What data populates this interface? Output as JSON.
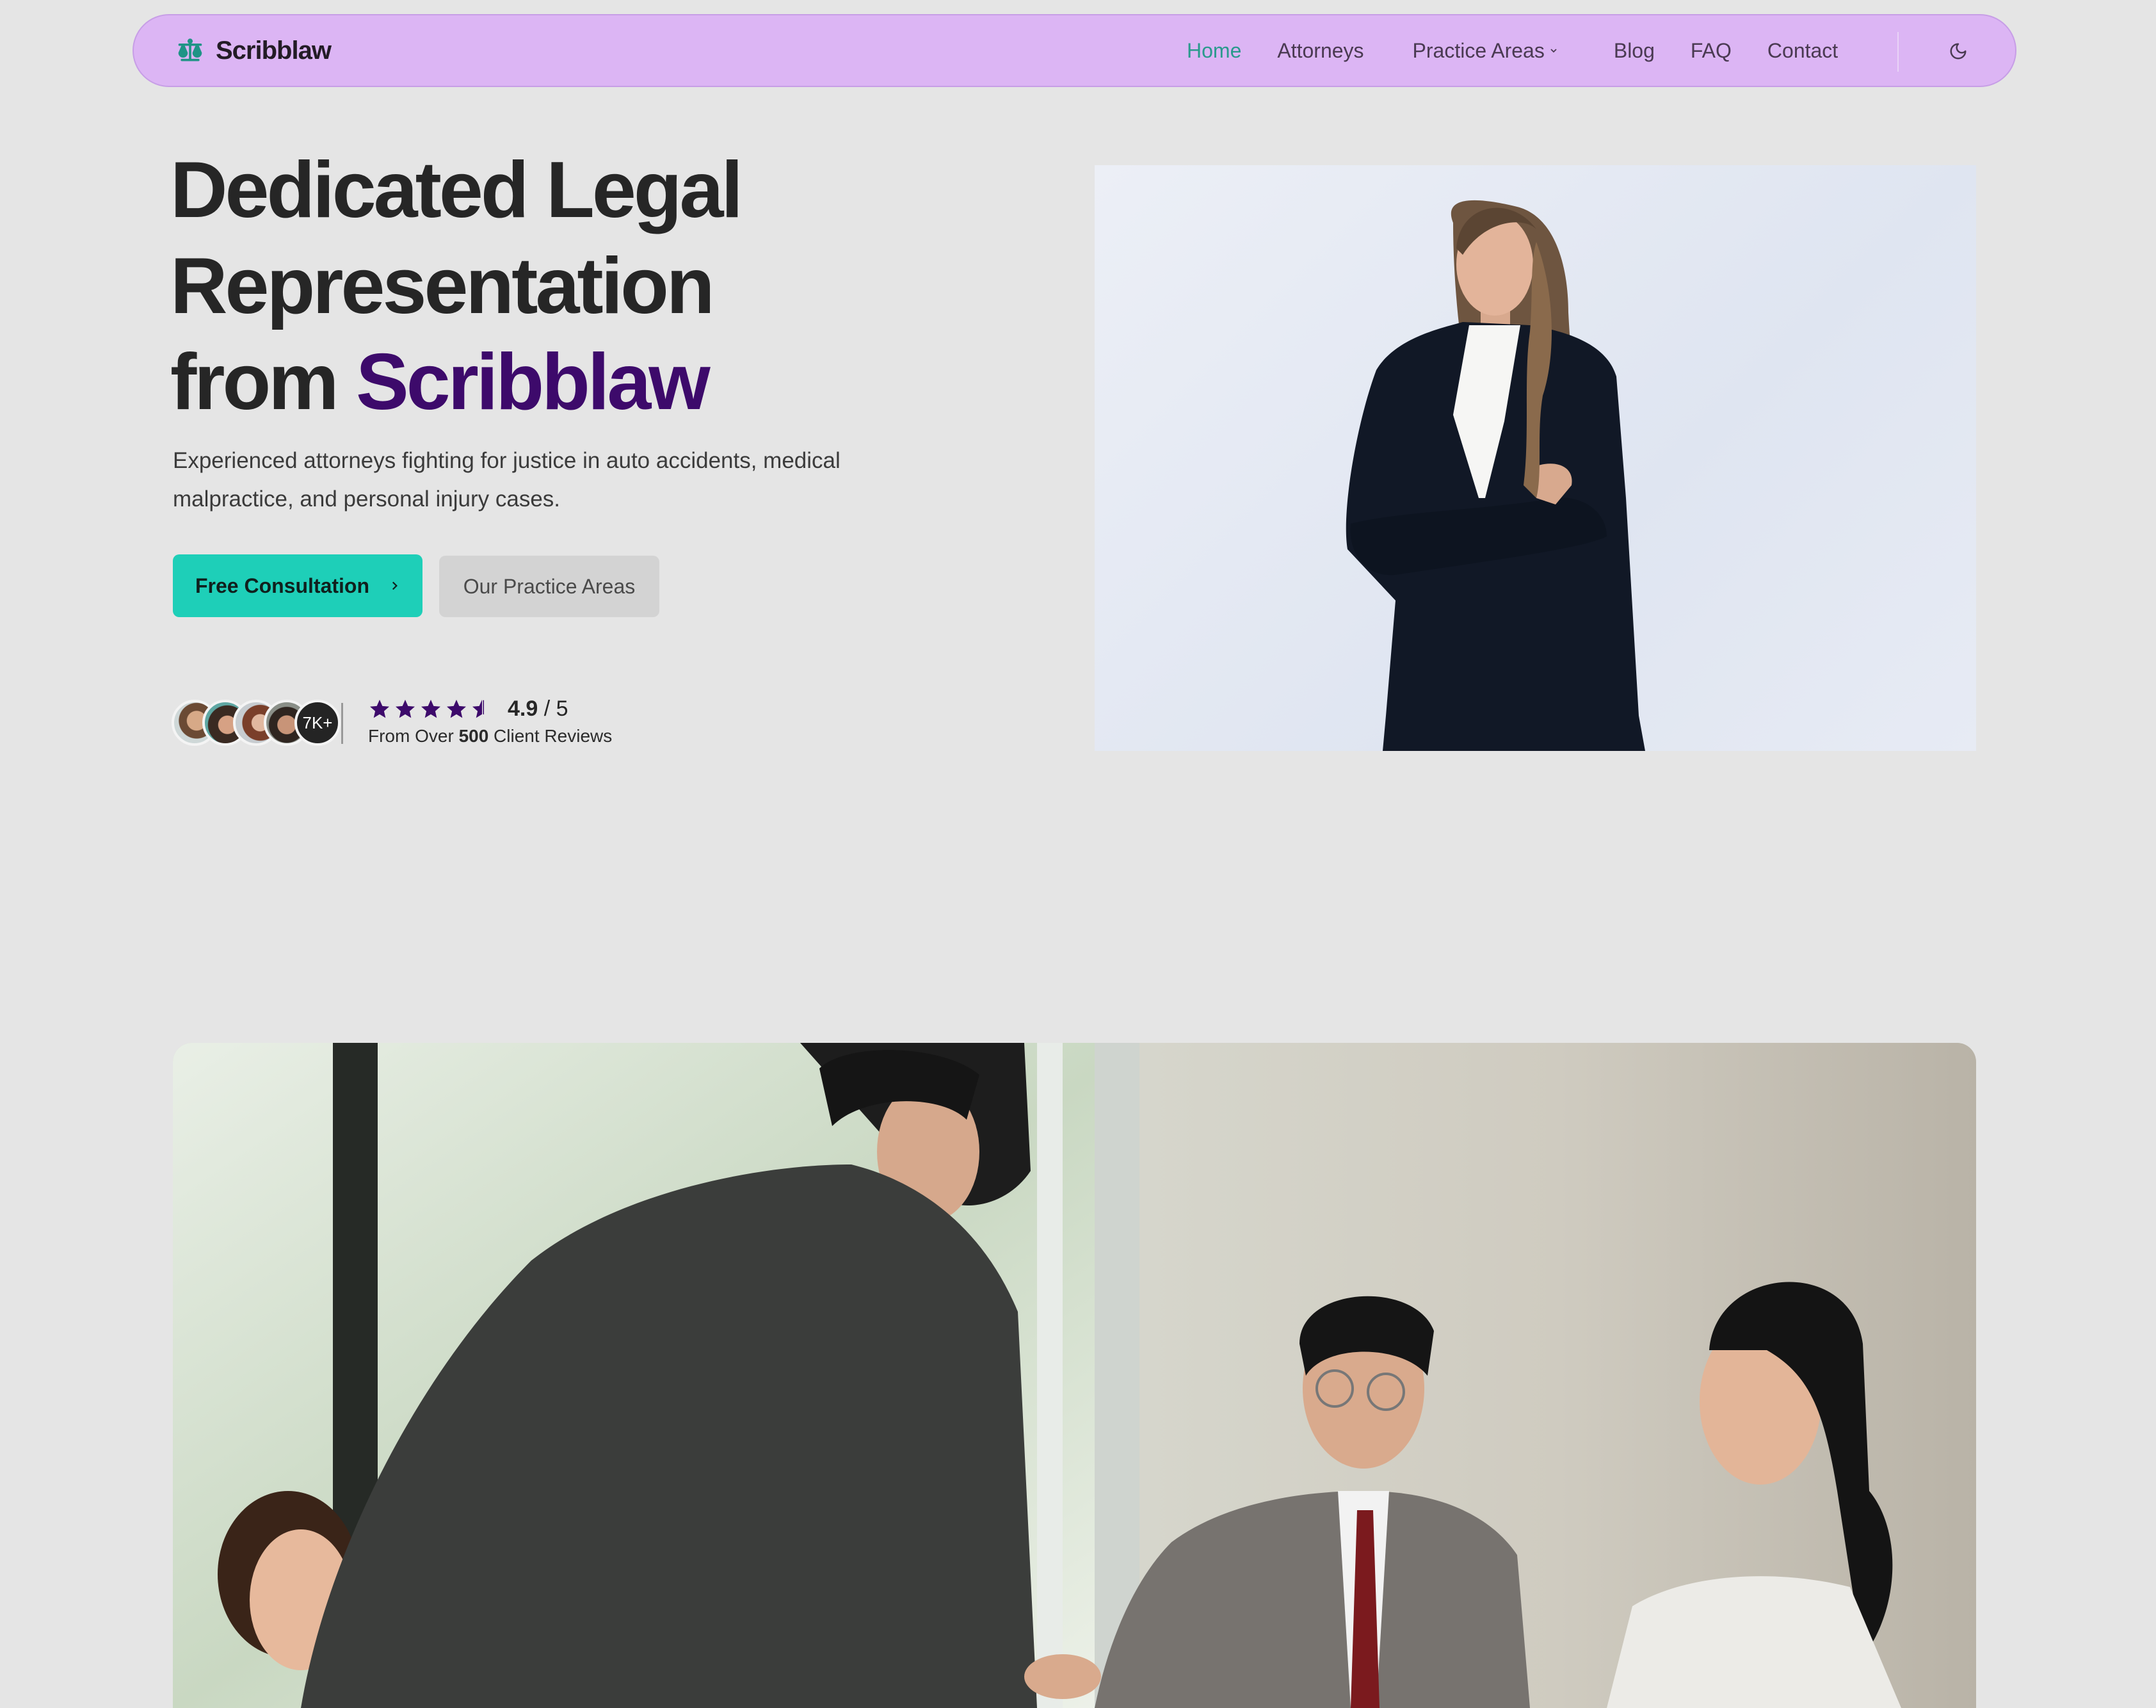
{
  "brand": {
    "name": "Scribblaw",
    "logo_icon": "scales-of-justice-icon",
    "accent_teal": "#2a9a8c",
    "accent_purple": "#3d0a6b",
    "nav_bg": "#dcb5f4",
    "cta_bg": "#1ecfb8"
  },
  "nav": {
    "items": [
      {
        "label": "Home",
        "active": true
      },
      {
        "label": "Attorneys",
        "active": false
      },
      {
        "label": "Practice Areas",
        "active": false,
        "has_dropdown": true
      },
      {
        "label": "Blog",
        "active": false
      },
      {
        "label": "FAQ",
        "active": false
      },
      {
        "label": "Contact",
        "active": false
      }
    ],
    "theme_toggle_icon": "moon-icon"
  },
  "hero": {
    "title_line1": "Dedicated Legal",
    "title_line2": "Representation",
    "title_line3_prefix": "from ",
    "title_line3_brand": "Scribblaw",
    "subtitle": "Experienced attorneys fighting for justice in auto accidents, medical malpractice, and personal injury cases.",
    "primary_button": "Free Consultation",
    "secondary_button": "Our Practice Areas",
    "image_alt": "Attorney in black suit with arms crossed"
  },
  "rating": {
    "client_count_badge": "7K+",
    "avatar_count": 4,
    "score": "4.9",
    "out_of": "/ 5",
    "stars_value": 4.5,
    "stars_max": 5,
    "reviews_prefix": "From Over ",
    "reviews_count": "500",
    "reviews_suffix": " Client Reviews"
  },
  "team_image": {
    "alt": "Attorneys shaking hands with clients in an office"
  }
}
